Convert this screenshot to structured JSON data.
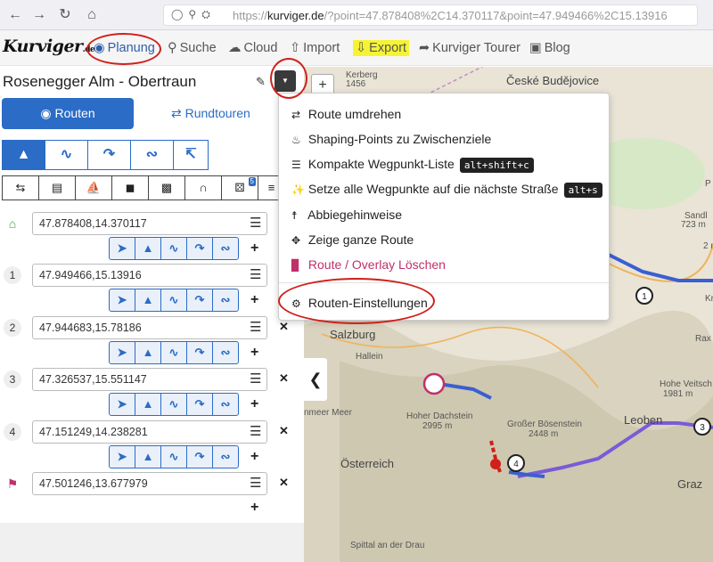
{
  "browser": {
    "url_prefix": "https://",
    "url_host": "kurviger.de",
    "url_rest": "/?point=47.878408%2C14.370117&point=47.949466%2C15.13916"
  },
  "nav": {
    "logo": "Kurviger",
    "logo_suffix": ".de",
    "items": {
      "planung": "Planung",
      "suche": "Suche",
      "cloud": "Cloud",
      "import": "Import",
      "export": "Export",
      "tourer": "Kurviger Tourer",
      "blog": "Blog"
    }
  },
  "route": {
    "title": "Rosenegger Alm - Obertraun",
    "tab_routen": "Routen",
    "tab_rundtouren": "Rundtouren"
  },
  "options_badge": "5",
  "waypoints": [
    {
      "marker": "",
      "value": "47.878408,14.370117"
    },
    {
      "marker": "1",
      "value": "47.949466,15.13916"
    },
    {
      "marker": "2",
      "value": "47.944683,15.78186"
    },
    {
      "marker": "3",
      "value": "47.326537,15.551147"
    },
    {
      "marker": "4",
      "value": "47.151249,14.238281"
    },
    {
      "marker": "",
      "value": "47.501246,13.677979"
    }
  ],
  "menu": {
    "reverse": "Route umdrehen",
    "shaping": "Shaping-Points zu Zwischenziele",
    "compact": "Kompakte Wegpunkt-Liste",
    "compact_key": "alt+shift+c",
    "snap": "Setze alle Wegpunkte auf die nächste Straße",
    "snap_key": "alt+s",
    "directions": "Abbiegehinweise",
    "show_all": "Zeige ganze Route",
    "delete": "Route / Overlay Löschen",
    "settings": "Routen-Einstellungen"
  },
  "map_labels": {
    "ceske": "České Budějovice",
    "kerberg": "Kerberg",
    "kerberg_h": "1456",
    "sandl": "Sandl",
    "sandl_h": "723 m",
    "salzburg": "Salzburg",
    "hallein": "Hallein",
    "nmeer": "nmeer Meer",
    "dachstein": "Hoher Dachstein",
    "dachstein_h": "2995 m",
    "boesenstein": "Großer Bösenstein",
    "boesenstein_h": "2448 m",
    "leoben": "Leoben",
    "veitsch": "Hohe Veitsch",
    "veitsch_h": "1981 m",
    "oesterreich": "Österreich",
    "graz": "Graz",
    "spittal": "Spittal an der Drau",
    "rax": "Rax",
    "kr": "Kr",
    "wels_h": "2 m",
    "p": "P"
  },
  "colors": {
    "accent": "#2b6cc6",
    "route": "#3a5fd0",
    "route_alt": "#7b5bd6",
    "highlight": "#f6f335",
    "annotation": "#d0201a"
  }
}
